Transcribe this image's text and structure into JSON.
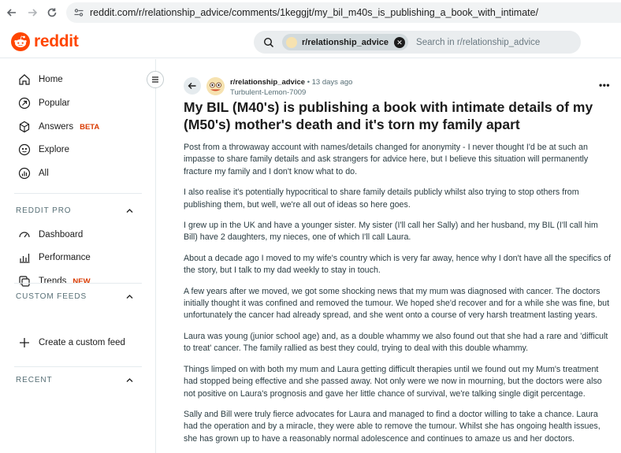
{
  "browser": {
    "url": "reddit.com/r/relationship_advice/comments/1keggjt/my_bil_m40s_is_publishing_a_book_with_intimate/"
  },
  "header": {
    "logo_text": "reddit",
    "brand_color": "#ff4500",
    "search": {
      "chip_label": "r/relationship_advice",
      "placeholder": "Search in r/relationship_advice"
    }
  },
  "sidebar": {
    "nav": [
      {
        "label": "Home",
        "icon": "home-icon"
      },
      {
        "label": "Popular",
        "icon": "popular-icon"
      },
      {
        "label": "Answers",
        "icon": "answers-icon",
        "badge": "BETA"
      },
      {
        "label": "Explore",
        "icon": "explore-icon"
      },
      {
        "label": "All",
        "icon": "all-icon"
      }
    ],
    "reddit_pro": {
      "title": "REDDIT PRO",
      "items": [
        {
          "label": "Dashboard",
          "icon": "dashboard-icon"
        },
        {
          "label": "Performance",
          "icon": "performance-icon"
        },
        {
          "label": "Trends",
          "icon": "trends-icon",
          "badge": "NEW"
        }
      ]
    },
    "custom_feeds": {
      "title": "CUSTOM FEEDS",
      "create_label": "Create a custom feed"
    },
    "recent": {
      "title": "RECENT"
    }
  },
  "post": {
    "subreddit": "r/relationship_advice",
    "time": "• 13 days ago",
    "author": "Turbulent-Lemon-7009",
    "more": "•••",
    "title": "My BIL (M40's) is publishing a book with intimate details of my (M50's) mother's death and it's torn my family apart",
    "paragraphs": [
      "Post from a throwaway account with names/details changed for anonymity - I never thought I'd be at such an impasse to share family details and ask strangers for advice here, but I believe this situation will permanently fracture my family and I don't know what to do.",
      "I also realise it's potentially hypocritical to share family details publicly whilst also trying to stop others from publishing them, but well, we're all out of ideas so here goes.",
      "I grew up in the UK and have a younger sister. My sister (I'll call her Sally) and her husband, my BIL (I'll call him Bill) have 2 daughters, my nieces, one of which I'll call Laura.",
      "About a decade ago I moved to my wife's country which is very far away, hence why I don't have all the specifics of the story, but I talk to my dad weekly to stay in touch.",
      "A few years after we moved, we got some shocking news that my mum was diagnosed with cancer. The doctors initially thought it was confined and removed the tumour. We hoped she'd recover and for a while she was fine, but unfortunately the cancer had already spread, and she went onto a course of very harsh treatment lasting years.",
      "Laura was young (junior school age) and, as a double whammy we also found out that she had a rare and 'difficult to treat' cancer. The family rallied as best they could, trying to deal with this double whammy.",
      "Things limped on with both my mum and Laura getting difficult therapies until we found out my Mum's treatment had stopped being effective and she passed away. Not only were we now in mourning, but the doctors were also not positive on Laura's prognosis and gave her little chance of survival, we're talking single digit percentage.",
      "Sally and Bill were truly fierce advocates for Laura and managed to find a doctor willing to take a chance. Laura had the operation and by a miracle, they were able to remove the tumour. Whilst she has ongoing health issues, she has grown up to have a reasonably normal adolescence and continues to amaze us and her doctors."
    ]
  }
}
